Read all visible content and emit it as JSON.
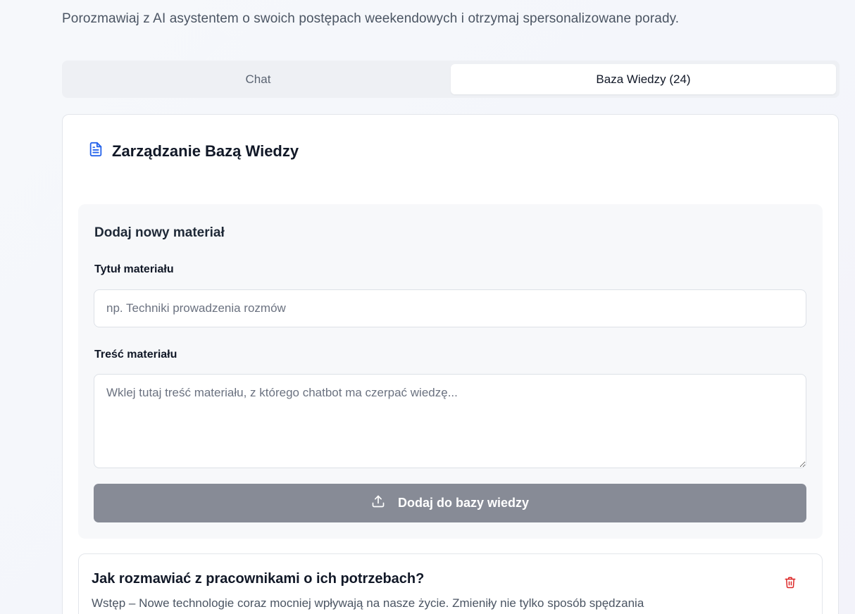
{
  "intro_text": "Porozmawiaj z AI asystentem o swoich postępach weekendowych i otrzymaj spersonalizowane porady.",
  "tabs": [
    {
      "label": "Chat",
      "active": false
    },
    {
      "label": "Baza Wiedzy (24)",
      "active": true
    }
  ],
  "knowledge": {
    "title": "Zarządzanie Bazą Wiedzy",
    "title_icon": "document-icon",
    "form": {
      "heading": "Dodaj nowy materiał",
      "title_label": "Tytuł materiału",
      "title_placeholder": "np. Techniki prowadzenia rozmów",
      "title_value": "",
      "content_label": "Treść materiału",
      "content_placeholder": "Wklej tutaj treść materiału, z którego chatbot ma czerpać wiedzę...",
      "content_value": "",
      "submit_label": "Dodaj do bazy wiedzy",
      "submit_icon": "upload-icon"
    },
    "items": [
      {
        "title": "Jak rozmawiać z pracownikami o ich potrzebach?",
        "preview": "Wstęp – Nowe technologie coraz mocniej wpływają na nasze życie. Zmieniły nie tylko sposób spędzania",
        "delete_icon": "trash-icon"
      }
    ]
  },
  "colors": {
    "accent": "#2563eb",
    "submit_bg": "#878b96",
    "danger": "#dc2626"
  }
}
